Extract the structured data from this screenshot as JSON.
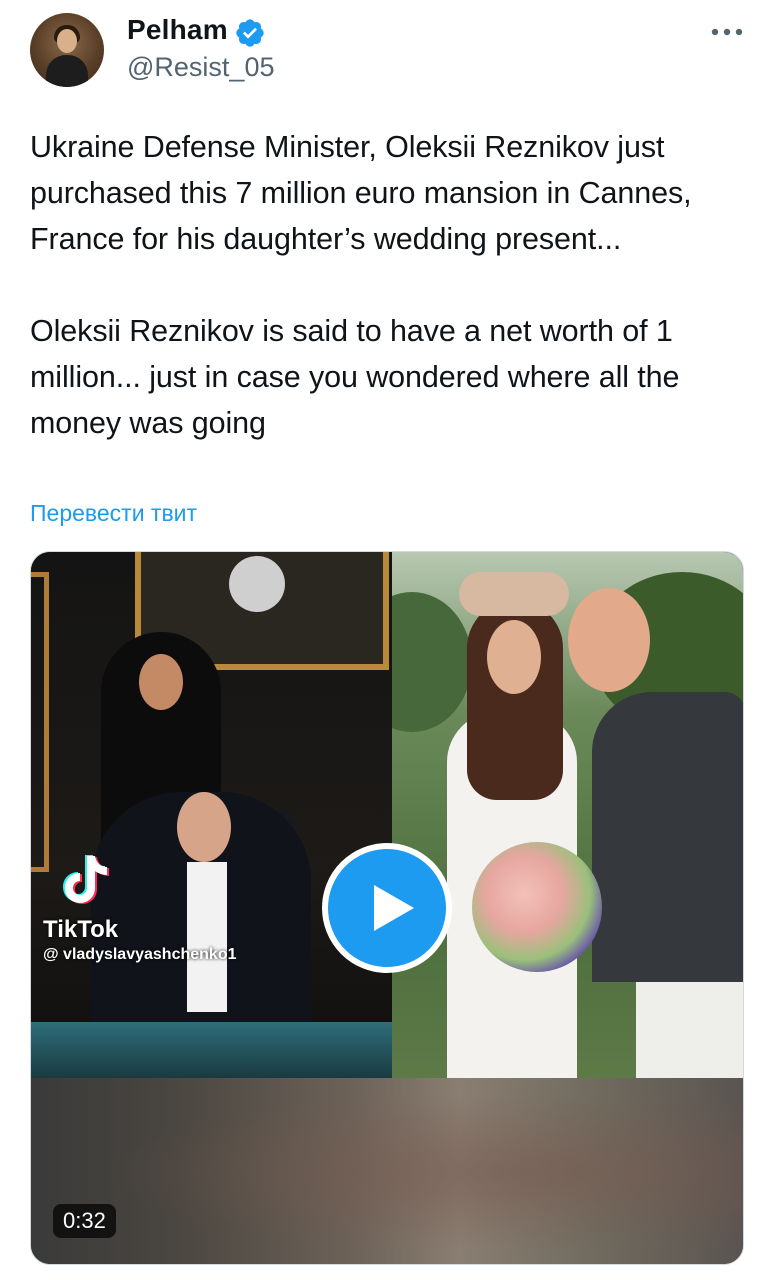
{
  "author": {
    "display_name": "Pelham",
    "handle": "@Resist_05",
    "avatar_icon": "profile-photo",
    "verified_icon": "verified-badge-icon",
    "verified_color": "#1d9bf0"
  },
  "menu": {
    "icon": "more-horizontal-icon"
  },
  "tweet": {
    "text": "Ukraine Defense Minister, Oleksii Reznikov just purchased this 7 million euro mansion in Cannes, France for his daughter’s wedding present...\n\nOleksii Reznikov is said to have a net worth of 1 million... just in case you wondered where all the money was going",
    "translate_label": "Перевести твит"
  },
  "media": {
    "watermark_brand": "TikTok",
    "watermark_handle": "@ vladyslavyashchenko1",
    "play_icon": "play-icon",
    "play_color": "#1d9bf0",
    "duration": "0:32"
  }
}
